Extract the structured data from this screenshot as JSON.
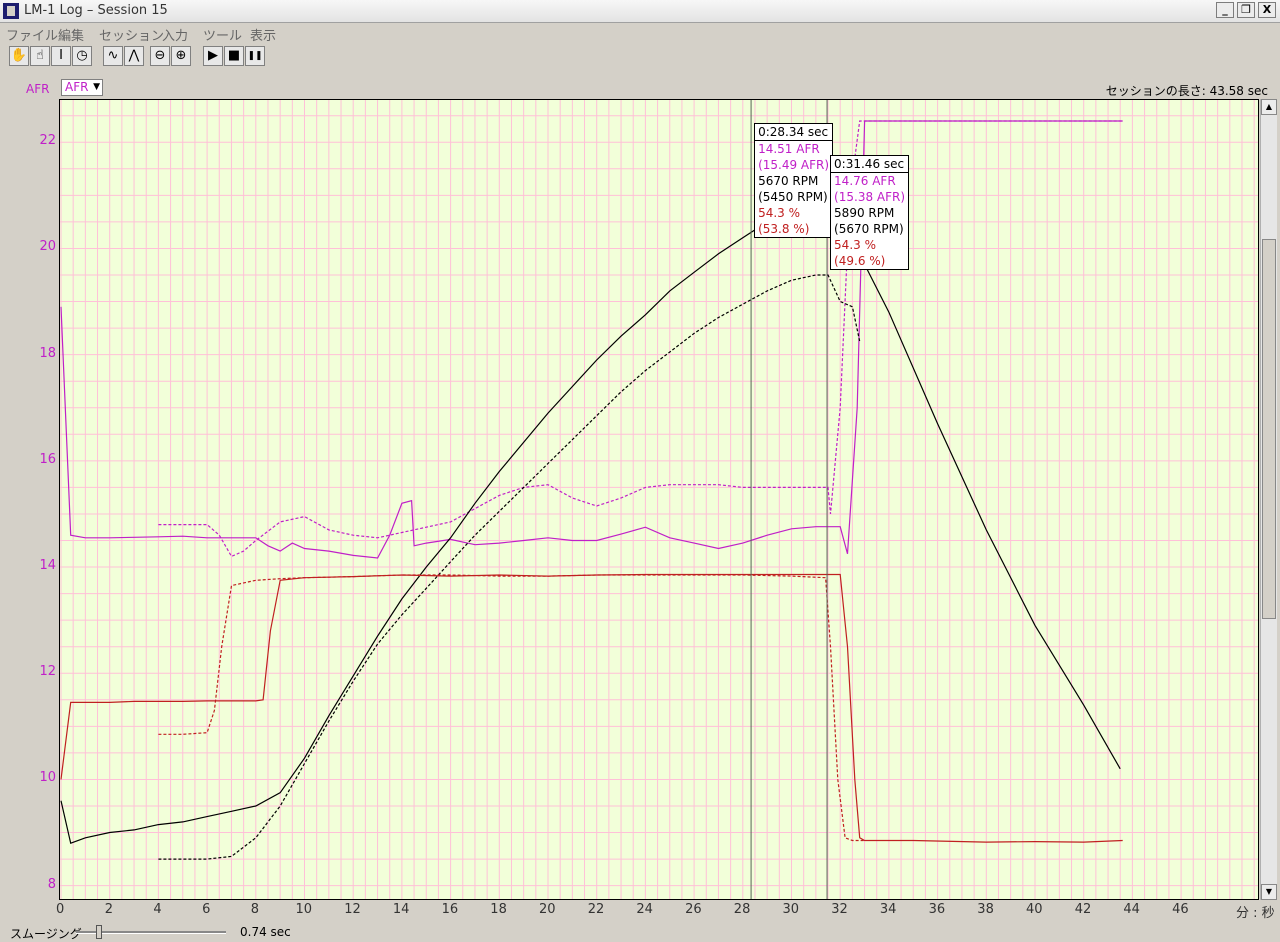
{
  "window": {
    "title": "LM-1 Log – Session 15",
    "minimize_label": "_",
    "restore_label": "❐",
    "close_label": "X"
  },
  "menu": [
    "ファイル",
    "編集",
    "セッション",
    "入力",
    "ツール",
    "表示"
  ],
  "toolbar": {
    "icons": [
      "hand-icon",
      "hand-cursor-icon",
      "text-cursor-icon",
      "clock-icon",
      "wave-icon",
      "spike-icon",
      "zoom-out-icon",
      "zoom-in-icon",
      "play-icon",
      "stop-icon",
      "pause-icon"
    ],
    "glyphs": [
      "✋",
      "☝",
      "I",
      "◷",
      "∿",
      "⋀",
      "⊖",
      "⊕",
      "▶",
      "■",
      "❚❚"
    ]
  },
  "axis_selector": {
    "label": "AFR",
    "selected": "AFR"
  },
  "session_length": "セッションの長さ:  43.58 sec",
  "colors": {
    "afr": "#c020c8",
    "rpm": "#000000",
    "pct": "#c02020",
    "plot_bg": "#f2ffd9",
    "grid": "#ffc0d8"
  },
  "chart_data": {
    "type": "line",
    "x_unit": "分 : 秒",
    "xlim": [
      0,
      49
    ],
    "ylim": [
      7.2,
      22.5
    ],
    "x_ticks": [
      "0",
      "2",
      "4",
      "6",
      "8",
      "10",
      "12",
      "14",
      "16",
      "18",
      "20",
      "22",
      "24",
      "26",
      "28",
      "30",
      "32",
      "34",
      "36",
      "38",
      "40",
      "42",
      "44",
      "46"
    ],
    "y_ticks": [
      "8",
      "10",
      "12",
      "14",
      "16",
      "18",
      "20",
      "22"
    ],
    "grid": true,
    "series": [
      {
        "color": "#c020c8",
        "dashed": false,
        "points": [
          [
            0,
            18.9
          ],
          [
            0.4,
            14.6
          ],
          [
            1,
            14.55
          ],
          [
            2,
            14.55
          ],
          [
            3,
            14.56
          ],
          [
            4,
            14.57
          ],
          [
            5,
            14.58
          ],
          [
            6,
            14.55
          ],
          [
            7,
            14.55
          ],
          [
            8,
            14.55
          ],
          [
            8.5,
            14.4
          ],
          [
            9,
            14.3
          ],
          [
            9.5,
            14.45
          ],
          [
            10,
            14.35
          ],
          [
            11,
            14.3
          ],
          [
            12,
            14.22
          ],
          [
            13,
            14.17
          ],
          [
            13.5,
            14.6
          ],
          [
            14,
            15.2
          ],
          [
            14.4,
            15.25
          ],
          [
            14.5,
            14.4
          ],
          [
            15,
            14.45
          ],
          [
            16,
            14.52
          ],
          [
            17,
            14.42
          ],
          [
            18,
            14.45
          ],
          [
            19,
            14.5
          ],
          [
            20,
            14.55
          ],
          [
            21,
            14.5
          ],
          [
            22,
            14.5
          ],
          [
            23,
            14.62
          ],
          [
            24,
            14.75
          ],
          [
            25,
            14.55
          ],
          [
            26,
            14.45
          ],
          [
            27,
            14.35
          ],
          [
            28,
            14.45
          ],
          [
            29,
            14.6
          ],
          [
            30,
            14.72
          ],
          [
            31,
            14.76
          ],
          [
            32,
            14.76
          ],
          [
            32.3,
            14.25
          ],
          [
            32.7,
            17
          ],
          [
            33,
            22.4
          ],
          [
            34,
            22.4
          ],
          [
            38,
            22.4
          ],
          [
            43.6,
            22.4
          ]
        ]
      },
      {
        "color": "#c020c8",
        "dashed": true,
        "points": [
          [
            4,
            14.8
          ],
          [
            5,
            14.8
          ],
          [
            6,
            14.8
          ],
          [
            6.5,
            14.6
          ],
          [
            7,
            14.2
          ],
          [
            7.5,
            14.3
          ],
          [
            8,
            14.5
          ],
          [
            9,
            14.85
          ],
          [
            10,
            14.95
          ],
          [
            11,
            14.7
          ],
          [
            12,
            14.6
          ],
          [
            13,
            14.55
          ],
          [
            14,
            14.65
          ],
          [
            15,
            14.75
          ],
          [
            16,
            14.85
          ],
          [
            17,
            15.1
          ],
          [
            18,
            15.35
          ],
          [
            19,
            15.5
          ],
          [
            20,
            15.55
          ],
          [
            21,
            15.3
          ],
          [
            22,
            15.15
          ],
          [
            23,
            15.3
          ],
          [
            24,
            15.5
          ],
          [
            25,
            15.55
          ],
          [
            26,
            15.55
          ],
          [
            27,
            15.55
          ],
          [
            28,
            15.5
          ],
          [
            29,
            15.5
          ],
          [
            30,
            15.5
          ],
          [
            31,
            15.5
          ],
          [
            31.5,
            15.5
          ],
          [
            31.6,
            15.0
          ],
          [
            32,
            17
          ],
          [
            32.4,
            21
          ],
          [
            32.8,
            22.4
          ],
          [
            34,
            22.4
          ],
          [
            43.6,
            22.4
          ]
        ]
      },
      {
        "color": "#000000",
        "dashed": false,
        "points": [
          [
            0,
            9.6
          ],
          [
            0.4,
            8.8
          ],
          [
            1,
            8.9
          ],
          [
            2,
            9.0
          ],
          [
            3,
            9.05
          ],
          [
            4,
            9.15
          ],
          [
            5,
            9.2
          ],
          [
            6,
            9.3
          ],
          [
            7,
            9.4
          ],
          [
            8,
            9.5
          ],
          [
            9,
            9.75
          ],
          [
            10,
            10.4
          ],
          [
            11,
            11.2
          ],
          [
            12,
            11.95
          ],
          [
            13,
            12.7
          ],
          [
            14,
            13.4
          ],
          [
            15,
            14.0
          ],
          [
            16,
            14.55
          ],
          [
            17,
            15.2
          ],
          [
            18,
            15.8
          ],
          [
            19,
            16.35
          ],
          [
            20,
            16.9
          ],
          [
            21,
            17.4
          ],
          [
            22,
            17.9
          ],
          [
            23,
            18.35
          ],
          [
            24,
            18.75
          ],
          [
            25,
            19.2
          ],
          [
            26,
            19.55
          ],
          [
            27,
            19.9
          ],
          [
            28,
            20.2
          ],
          [
            29,
            20.5
          ],
          [
            30,
            20.7
          ],
          [
            31,
            20.9
          ],
          [
            31.5,
            21.0
          ],
          [
            32,
            20.5
          ],
          [
            33,
            19.7
          ],
          [
            34,
            18.8
          ],
          [
            36,
            16.7
          ],
          [
            38,
            14.7
          ],
          [
            40,
            12.9
          ],
          [
            42,
            11.4
          ],
          [
            43.5,
            10.2
          ]
        ]
      },
      {
        "color": "#000000",
        "dashed": true,
        "points": [
          [
            4,
            8.5
          ],
          [
            5,
            8.5
          ],
          [
            6,
            8.5
          ],
          [
            7,
            8.55
          ],
          [
            8,
            8.9
          ],
          [
            9,
            9.5
          ],
          [
            10,
            10.3
          ],
          [
            11,
            11.1
          ],
          [
            12,
            11.85
          ],
          [
            13,
            12.55
          ],
          [
            14,
            13.1
          ],
          [
            15,
            13.6
          ],
          [
            16,
            14.1
          ],
          [
            17,
            14.6
          ],
          [
            18,
            15.05
          ],
          [
            19,
            15.5
          ],
          [
            20,
            15.95
          ],
          [
            21,
            16.4
          ],
          [
            22,
            16.85
          ],
          [
            23,
            17.3
          ],
          [
            24,
            17.7
          ],
          [
            25,
            18.05
          ],
          [
            26,
            18.4
          ],
          [
            27,
            18.7
          ],
          [
            28,
            18.95
          ],
          [
            29,
            19.2
          ],
          [
            30,
            19.4
          ],
          [
            31,
            19.5
          ],
          [
            31.5,
            19.5
          ],
          [
            32,
            19.0
          ],
          [
            32.5,
            18.9
          ],
          [
            32.8,
            18.25
          ]
        ]
      },
      {
        "color": "#c02020",
        "dashed": false,
        "points": [
          [
            0,
            10.0
          ],
          [
            0.4,
            11.45
          ],
          [
            1,
            11.45
          ],
          [
            2,
            11.45
          ],
          [
            3,
            11.47
          ],
          [
            4,
            11.47
          ],
          [
            5,
            11.47
          ],
          [
            6,
            11.48
          ],
          [
            7,
            11.48
          ],
          [
            8,
            11.48
          ],
          [
            8.3,
            11.5
          ],
          [
            8.6,
            12.8
          ],
          [
            9,
            13.75
          ],
          [
            10,
            13.8
          ],
          [
            12,
            13.82
          ],
          [
            14,
            13.85
          ],
          [
            16,
            13.83
          ],
          [
            18,
            13.85
          ],
          [
            20,
            13.83
          ],
          [
            22,
            13.85
          ],
          [
            24,
            13.86
          ],
          [
            26,
            13.86
          ],
          [
            28,
            13.86
          ],
          [
            30,
            13.86
          ],
          [
            31,
            13.86
          ],
          [
            32,
            13.86
          ],
          [
            32.3,
            12.5
          ],
          [
            32.6,
            10.0
          ],
          [
            32.8,
            8.9
          ],
          [
            33,
            8.85
          ],
          [
            35,
            8.85
          ],
          [
            38,
            8.82
          ],
          [
            40,
            8.83
          ],
          [
            42,
            8.82
          ],
          [
            43.6,
            8.85
          ]
        ]
      },
      {
        "color": "#c02020",
        "dashed": true,
        "points": [
          [
            4,
            10.85
          ],
          [
            5,
            10.85
          ],
          [
            6,
            10.88
          ],
          [
            6.3,
            11.3
          ],
          [
            6.6,
            12.5
          ],
          [
            7,
            13.65
          ],
          [
            8,
            13.75
          ],
          [
            9,
            13.78
          ],
          [
            10,
            13.8
          ],
          [
            12,
            13.82
          ],
          [
            14,
            13.85
          ],
          [
            16,
            13.85
          ],
          [
            18,
            13.83
          ],
          [
            20,
            13.83
          ],
          [
            22,
            13.85
          ],
          [
            24,
            13.85
          ],
          [
            26,
            13.85
          ],
          [
            28,
            13.85
          ],
          [
            30,
            13.83
          ],
          [
            31.4,
            13.8
          ],
          [
            31.6,
            12.5
          ],
          [
            31.9,
            10.0
          ],
          [
            32.2,
            8.9
          ],
          [
            32.5,
            8.85
          ],
          [
            33,
            8.85
          ]
        ]
      }
    ],
    "cursors": [
      {
        "x": 28.34,
        "time": "0:28.34 sec",
        "rows": [
          {
            "text": "14.51 AFR",
            "color": "#c020c8"
          },
          {
            "text": "(15.49 AFR)",
            "color": "#c020c8"
          },
          {
            "text": "5670 RPM",
            "color": "#000000"
          },
          {
            "text": "(5450 RPM)",
            "color": "#000000"
          },
          {
            "text": "54.3 %",
            "color": "#c02020"
          },
          {
            "text": "(53.8 %)",
            "color": "#c02020"
          }
        ]
      },
      {
        "x": 31.46,
        "time": "0:31.46 sec",
        "rows": [
          {
            "text": "14.76 AFR",
            "color": "#c020c8"
          },
          {
            "text": "(15.38 AFR)",
            "color": "#c020c8"
          },
          {
            "text": "5890 RPM",
            "color": "#000000"
          },
          {
            "text": "(5670 RPM)",
            "color": "#000000"
          },
          {
            "text": "54.3 %",
            "color": "#c02020"
          },
          {
            "text": "(49.6 %)",
            "color": "#c02020"
          }
        ]
      }
    ]
  },
  "smoothing": {
    "label": "スムージング",
    "value": "0.74 sec",
    "level": 0.15
  }
}
